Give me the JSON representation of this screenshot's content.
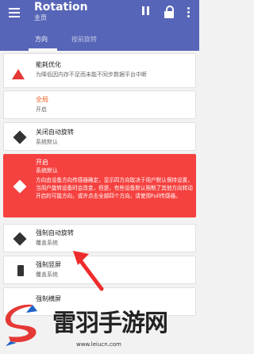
{
  "appbar": {
    "title": "Rotation",
    "subtitle": "主页",
    "actions": [
      "pause-icon",
      "lock-icon",
      "more-vert-icon"
    ],
    "tabs": [
      {
        "label": "方向",
        "active": true
      },
      {
        "label": "按前旋转",
        "active": false
      }
    ]
  },
  "cards": {
    "battery": {
      "title": "能耗优化",
      "desc": "为降低因内存不足而未能不同步数据平台中断",
      "icon": "warning-icon"
    },
    "global": {
      "title": "全局",
      "sub": "开启"
    },
    "close_auto": {
      "title": "关闭自动旋转",
      "sub": "系统默认",
      "icon": "rotate-icon"
    },
    "enabled": {
      "title": "开启",
      "sub": "系统默认",
      "desc": "方向由设备方向传感器确定，显示四方向取决于用户默认保持设置，当用户旋转设备时会改变，但是，有些设备默认限制了其他方向转动开启的可能方向，或许点击全部四个方向，请使用Full传感器。",
      "icon": "rotate-icon"
    },
    "force_auto": {
      "title": "强制自动旋转",
      "sub": "覆盖系统",
      "icon": "rotate-icon"
    },
    "force_portrait": {
      "title": "强制竖屏",
      "sub": "覆盖系统",
      "icon": "portrait-icon"
    },
    "force_landscape": {
      "title": "强制横屏"
    }
  },
  "colors": {
    "appbar": "#5765b8",
    "warning": "#e53935",
    "accent_red": "#f5413f",
    "highlight": "#f25a1f"
  },
  "watermark": {
    "name": "雷羽手游网",
    "url": "www.leiucn.com"
  }
}
